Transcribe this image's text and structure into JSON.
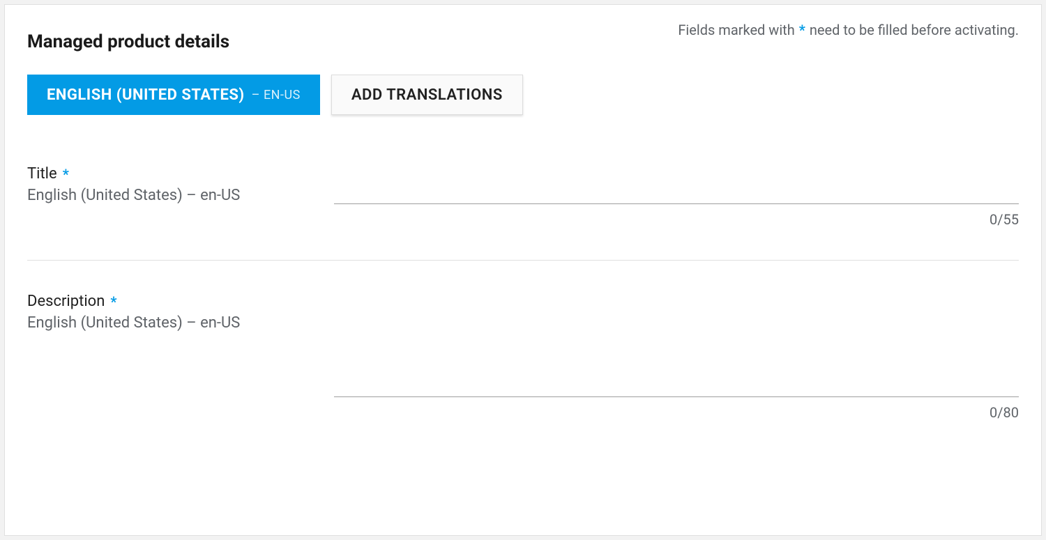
{
  "header": {
    "title": "Managed product details",
    "required_note_prefix": "Fields marked with",
    "required_note_star": "*",
    "required_note_suffix": "need to be filled before activating."
  },
  "tabs": {
    "active": {
      "language_name": "ENGLISH (UNITED STATES)",
      "language_suffix": "– EN-US"
    },
    "add_button_label": "ADD TRANSLATIONS"
  },
  "fields": {
    "title": {
      "label": "Title",
      "star": "*",
      "locale": "English (United States) – en-US",
      "value": "",
      "counter": "0/55"
    },
    "description": {
      "label": "Description",
      "star": "*",
      "locale": "English (United States) – en-US",
      "value": "",
      "counter": "0/80"
    }
  }
}
